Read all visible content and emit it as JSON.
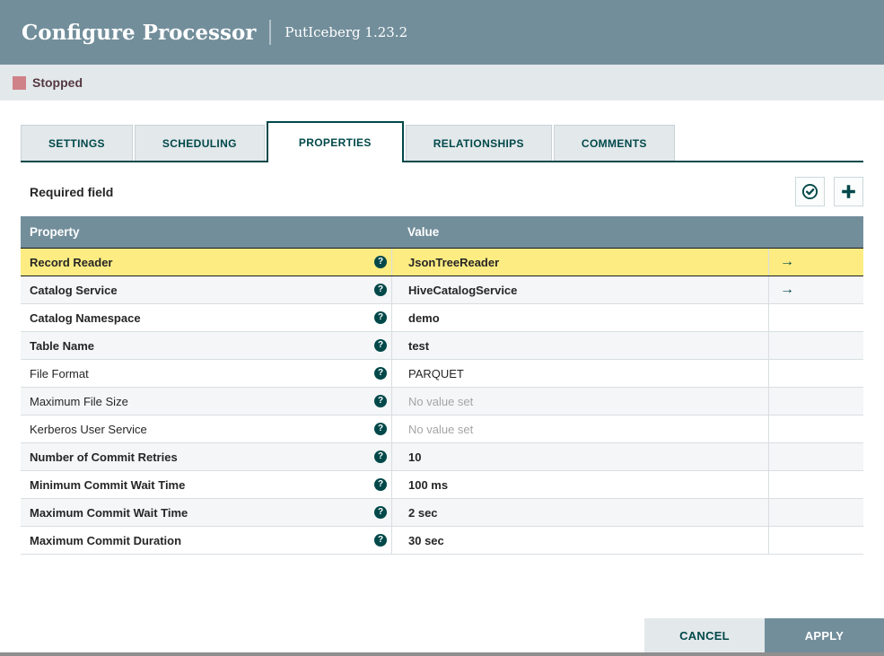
{
  "header": {
    "title": "Configure Processor",
    "subtitle": "PutIceberg 1.23.2"
  },
  "status": {
    "label": "Stopped",
    "color": "#CF8288"
  },
  "tabs": [
    {
      "label": "SETTINGS",
      "active": false
    },
    {
      "label": "SCHEDULING",
      "active": false
    },
    {
      "label": "PROPERTIES",
      "active": true
    },
    {
      "label": "RELATIONSHIPS",
      "active": false
    },
    {
      "label": "COMMENTS",
      "active": false
    }
  ],
  "toolbar": {
    "required_label": "Required field",
    "icons": [
      {
        "name": "check-circle-icon",
        "meaning": "verify-properties"
      },
      {
        "name": "plus-icon",
        "meaning": "add-property"
      }
    ]
  },
  "table": {
    "columns": {
      "property": "Property",
      "value": "Value"
    },
    "rows": [
      {
        "property": "Record Reader",
        "value": "JsonTreeReader",
        "required": true,
        "unset": false,
        "highlighted": true,
        "has_goto": true
      },
      {
        "property": "Catalog Service",
        "value": "HiveCatalogService",
        "required": true,
        "unset": false,
        "highlighted": false,
        "has_goto": true
      },
      {
        "property": "Catalog Namespace",
        "value": "demo",
        "required": true,
        "unset": false,
        "highlighted": false,
        "has_goto": false
      },
      {
        "property": "Table Name",
        "value": "test",
        "required": true,
        "unset": false,
        "highlighted": false,
        "has_goto": false
      },
      {
        "property": "File Format",
        "value": "PARQUET",
        "required": false,
        "unset": false,
        "highlighted": false,
        "has_goto": false
      },
      {
        "property": "Maximum File Size",
        "value": "No value set",
        "required": false,
        "unset": true,
        "highlighted": false,
        "has_goto": false
      },
      {
        "property": "Kerberos User Service",
        "value": "No value set",
        "required": false,
        "unset": true,
        "highlighted": false,
        "has_goto": false
      },
      {
        "property": "Number of Commit Retries",
        "value": "10",
        "required": true,
        "unset": false,
        "highlighted": false,
        "has_goto": false
      },
      {
        "property": "Minimum Commit Wait Time",
        "value": "100 ms",
        "required": true,
        "unset": false,
        "highlighted": false,
        "has_goto": false
      },
      {
        "property": "Maximum Commit Wait Time",
        "value": "2 sec",
        "required": true,
        "unset": false,
        "highlighted": false,
        "has_goto": false
      },
      {
        "property": "Maximum Commit Duration",
        "value": "30 sec",
        "required": true,
        "unset": false,
        "highlighted": false,
        "has_goto": false
      }
    ],
    "help_icon_glyph": "?",
    "goto_arrow_glyph": "→"
  },
  "footer": {
    "cancel_label": "CANCEL",
    "apply_label": "APPLY"
  },
  "colors": {
    "header_bg": "#728E9B",
    "status_bar_bg": "#E3E8EB",
    "accent_teal": "#004849",
    "row_highlight": "#FDEC82",
    "row_alt": "#F4F6F7",
    "unset_text": "#A5A5A5"
  }
}
